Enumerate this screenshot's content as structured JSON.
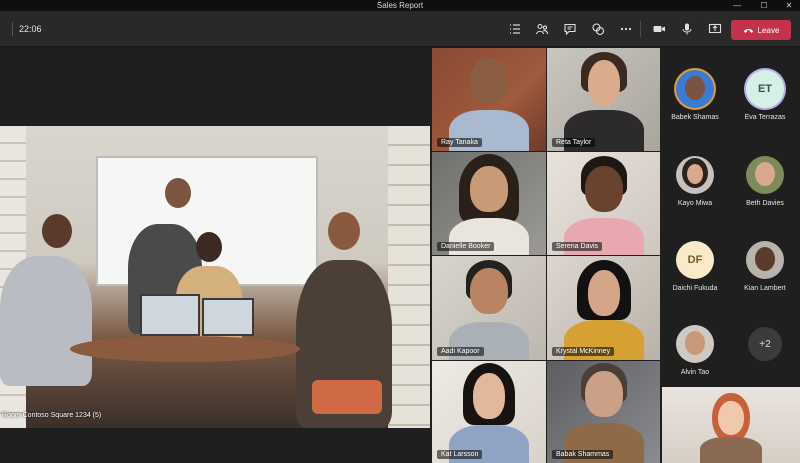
{
  "window": {
    "title": "Sales Report",
    "minimize": "—",
    "maximize": "☐",
    "close": "✕"
  },
  "toolbar": {
    "timer": "22:06",
    "leave_label": "Leave"
  },
  "room": {
    "label": "Room Contoso Square 1234 (5)"
  },
  "grid": [
    {
      "name": "Ray Tanaka"
    },
    {
      "name": "Reta Taylor"
    },
    {
      "name": "Danielle Booker"
    },
    {
      "name": "Serena Davis"
    },
    {
      "name": "Aadi Kapoor"
    },
    {
      "name": "Krystal McKinney"
    },
    {
      "name": "Kat Larsson"
    },
    {
      "name": "Babak Shammas"
    }
  ],
  "roster": [
    {
      "name": "Babek Shamas",
      "initials": ""
    },
    {
      "name": "Eva Terrazas",
      "initials": "ET"
    },
    {
      "name": "Kayo Miwa",
      "initials": ""
    },
    {
      "name": "Beth Davies",
      "initials": ""
    },
    {
      "name": "Daichi Fukuda",
      "initials": "DF"
    },
    {
      "name": "Kian Lambert",
      "initials": ""
    },
    {
      "name": "Alvin Tao",
      "initials": ""
    },
    {
      "name": "",
      "initials": "+2"
    }
  ],
  "colors": {
    "leave": "#c4314b",
    "ring_orange": "#e39a3b",
    "ring_lavender": "#b7b0e8"
  }
}
